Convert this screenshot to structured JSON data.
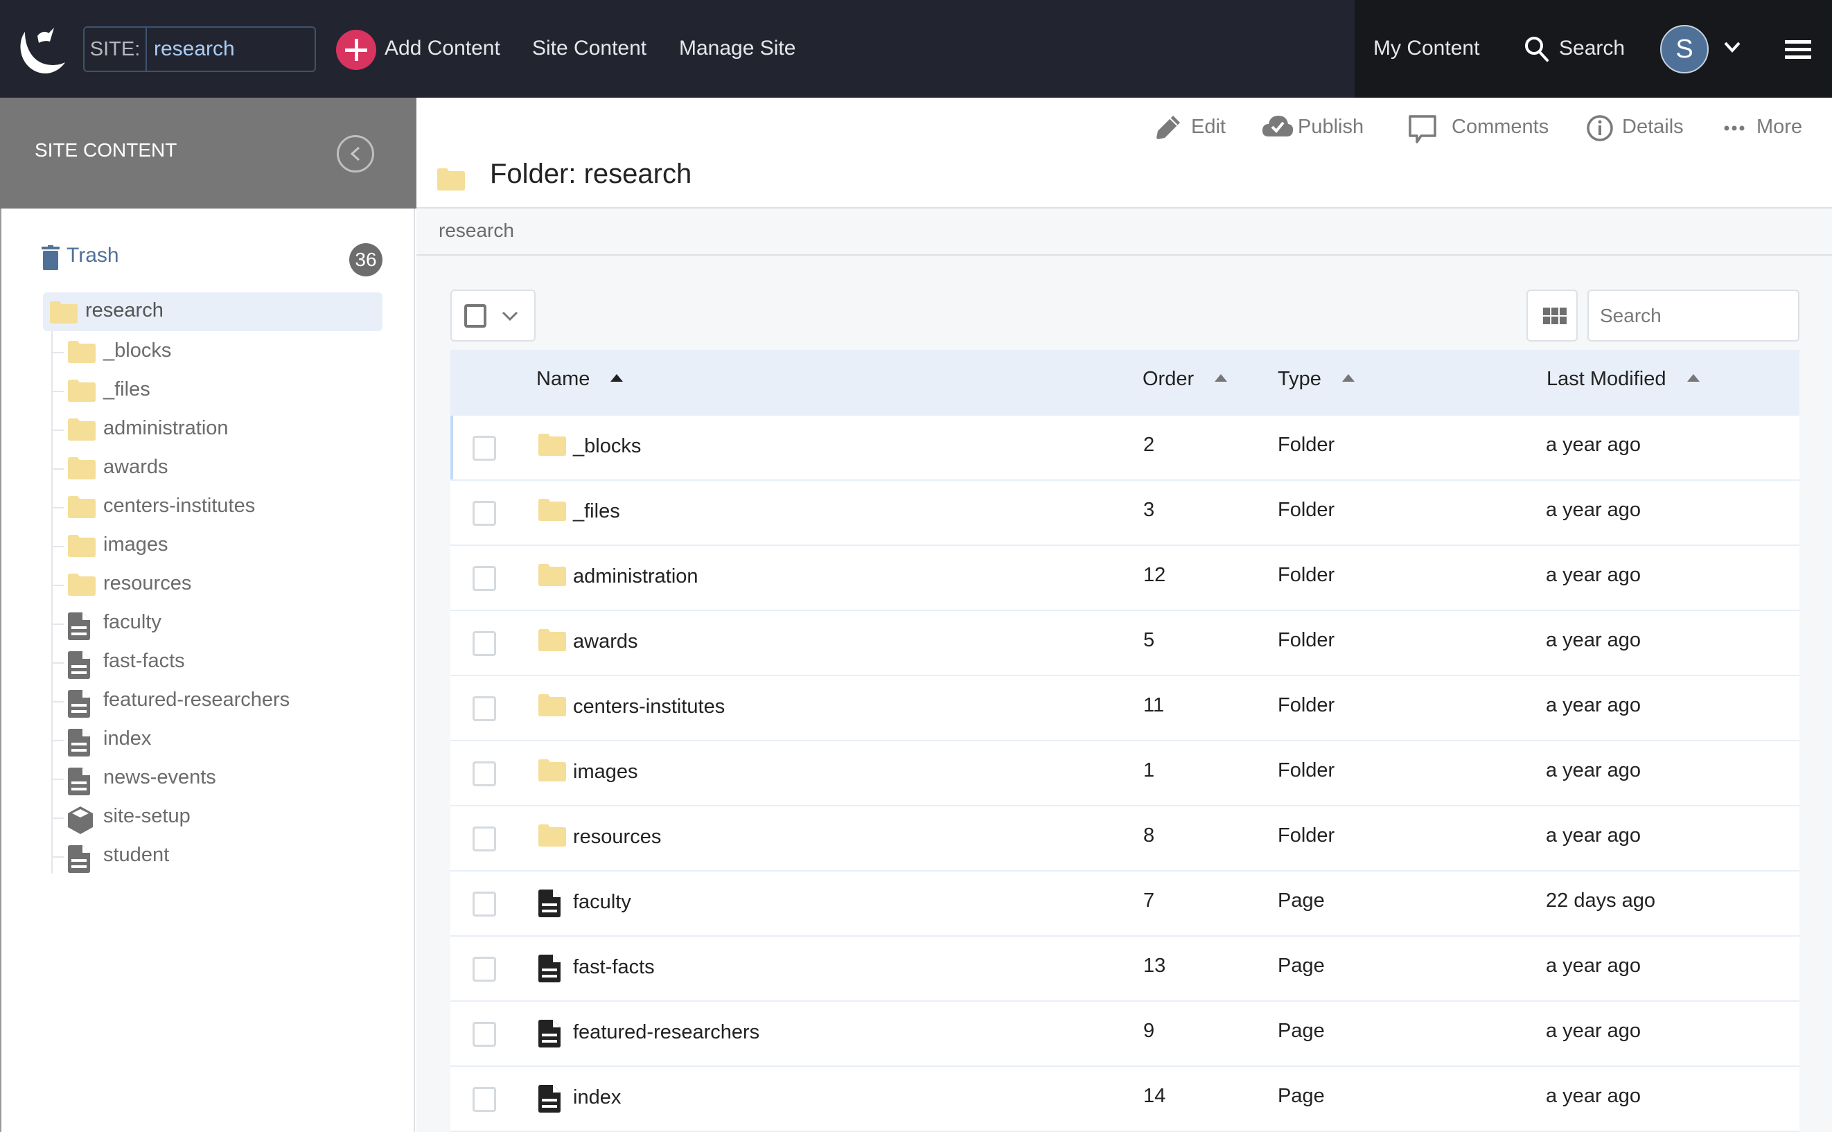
{
  "navbar": {
    "site_label": "SITE:",
    "site_value": "research",
    "add_content": "Add Content",
    "site_content": "Site Content",
    "manage_site": "Manage Site",
    "my_content": "My Content",
    "search": "Search",
    "avatar_initial": "S",
    "colors": {
      "bg": "#22252f",
      "right_bg": "#17181c",
      "add_accent": "#d9335f",
      "avatar": "#4f7198",
      "site_value": "#a9cdf5"
    }
  },
  "sidebar": {
    "title": "SITE CONTENT",
    "trash": {
      "label": "Trash",
      "count": "36"
    },
    "root": {
      "label": "research",
      "icon": "folder-icon"
    },
    "items": [
      {
        "label": "_blocks",
        "icon": "folder-icon"
      },
      {
        "label": "_files",
        "icon": "folder-icon"
      },
      {
        "label": "administration",
        "icon": "folder-icon"
      },
      {
        "label": "awards",
        "icon": "folder-icon"
      },
      {
        "label": "centers-institutes",
        "icon": "folder-icon"
      },
      {
        "label": "images",
        "icon": "folder-icon"
      },
      {
        "label": "resources",
        "icon": "folder-icon"
      },
      {
        "label": "faculty",
        "icon": "page-icon"
      },
      {
        "label": "fast-facts",
        "icon": "page-icon"
      },
      {
        "label": "featured-researchers",
        "icon": "page-icon"
      },
      {
        "label": "index",
        "icon": "page-icon"
      },
      {
        "label": "news-events",
        "icon": "page-icon"
      },
      {
        "label": "site-setup",
        "icon": "cube-icon"
      },
      {
        "label": "student",
        "icon": "page-icon"
      }
    ]
  },
  "toolbar": {
    "edit": "Edit",
    "publish": "Publish",
    "comments": "Comments",
    "details": "Details",
    "more": "More"
  },
  "page": {
    "title": "Folder: research",
    "breadcrumb": "research"
  },
  "listing": {
    "search_placeholder": "Search",
    "columns": [
      {
        "label": "Name",
        "sort": "asc",
        "active": true
      },
      {
        "label": "Order",
        "sort": "asc",
        "active": false
      },
      {
        "label": "Type",
        "sort": "asc",
        "active": false
      },
      {
        "label": "Last Modified",
        "sort": "asc",
        "active": false
      }
    ],
    "rows": [
      {
        "name": "_blocks",
        "icon": "folder-icon",
        "order": "2",
        "type": "Folder",
        "modified": "a year ago",
        "selected": true
      },
      {
        "name": "_files",
        "icon": "folder-icon",
        "order": "3",
        "type": "Folder",
        "modified": "a year ago"
      },
      {
        "name": "administration",
        "icon": "folder-icon",
        "order": "12",
        "type": "Folder",
        "modified": "a year ago"
      },
      {
        "name": "awards",
        "icon": "folder-icon",
        "order": "5",
        "type": "Folder",
        "modified": "a year ago"
      },
      {
        "name": "centers-institutes",
        "icon": "folder-icon",
        "order": "11",
        "type": "Folder",
        "modified": "a year ago"
      },
      {
        "name": "images",
        "icon": "folder-icon",
        "order": "1",
        "type": "Folder",
        "modified": "a year ago"
      },
      {
        "name": "resources",
        "icon": "folder-icon",
        "order": "8",
        "type": "Folder",
        "modified": "a year ago"
      },
      {
        "name": "faculty",
        "icon": "page-icon",
        "order": "7",
        "type": "Page",
        "modified": "22 days ago"
      },
      {
        "name": "fast-facts",
        "icon": "page-icon",
        "order": "13",
        "type": "Page",
        "modified": "a year ago"
      },
      {
        "name": "featured-researchers",
        "icon": "page-icon",
        "order": "9",
        "type": "Page",
        "modified": "a year ago"
      },
      {
        "name": "index",
        "icon": "page-icon",
        "order": "14",
        "type": "Page",
        "modified": "a year ago"
      }
    ]
  },
  "colors": {
    "folder": "#f5de97",
    "sidebar_header": "#777777",
    "selection": "#e8eff8",
    "content_bg": "#f5f7f9",
    "trash_blue": "#4f7198"
  }
}
